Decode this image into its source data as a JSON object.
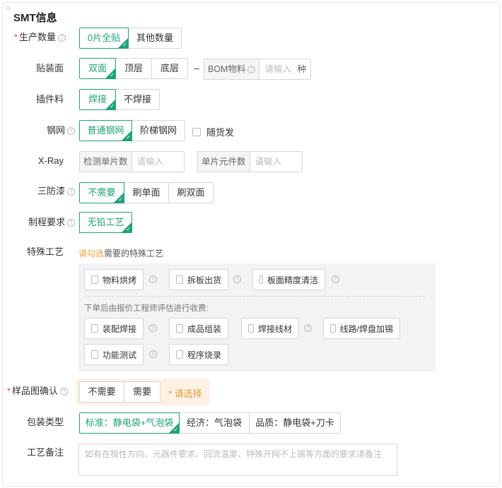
{
  "section_title": "SMT信息",
  "help_glyph": "?",
  "required_mark": "*",
  "check_glyph": "✓",
  "accent_color": "#1fa27a",
  "rows": {
    "quantity": {
      "label": "生产数量",
      "required": true,
      "options": [
        "0片全贴",
        "其他数量"
      ],
      "selected": 0
    },
    "mount_side": {
      "label": "贴装面",
      "options": [
        "双面",
        "顶层",
        "底层"
      ],
      "selected": 0,
      "bom": {
        "prefix": "BOM物料",
        "placeholder": "请输入",
        "suffix": "种"
      }
    },
    "through_hole": {
      "label": "插件料",
      "options": [
        "焊接",
        "不焊接"
      ],
      "selected": 0
    },
    "stencil": {
      "label": "钢网",
      "options": [
        "普通钢网",
        "阶梯钢网"
      ],
      "selected": 0,
      "ship_with_goods": "随货发"
    },
    "xray": {
      "label": "X-Ray",
      "test_count": {
        "prefix": "检测单片数",
        "placeholder": "请输入"
      },
      "component_count": {
        "prefix": "单片元件数",
        "placeholder": "请输入"
      }
    },
    "conformal": {
      "label": "三防漆",
      "options": [
        "不需要",
        "刷单面",
        "刷双面"
      ],
      "selected": 0
    },
    "process": {
      "label": "制程要求",
      "options": [
        "无铅工艺"
      ],
      "selected": 0
    },
    "special": {
      "label": "特殊工艺",
      "hint_highlight": "请勾选",
      "hint_rest": "需要的特殊工艺",
      "group1": [
        "物料烘烤",
        "拆板出货",
        "板面精度清洁"
      ],
      "note": "下单后由报价工程师评估进行收费:",
      "group2": [
        "装配焊接",
        "成品组装",
        "焊接线材",
        "线路/焊盘加锡",
        "功能测试",
        "程序烧录"
      ]
    },
    "sample": {
      "label": "样品图确认",
      "required": true,
      "options": [
        "不需要",
        "需要"
      ],
      "warning": "* 请选择"
    },
    "packaging": {
      "label": "包装类型",
      "options": [
        "标准：静电袋+气泡袋",
        "经济：气泡袋",
        "品质：静电袋+刀卡"
      ],
      "selected": 0
    },
    "remarks": {
      "label": "工艺备注",
      "placeholder": "如有在极性方向、元器件要求、回流温度、特殊开网不上锡等方面的要求请备注"
    }
  }
}
